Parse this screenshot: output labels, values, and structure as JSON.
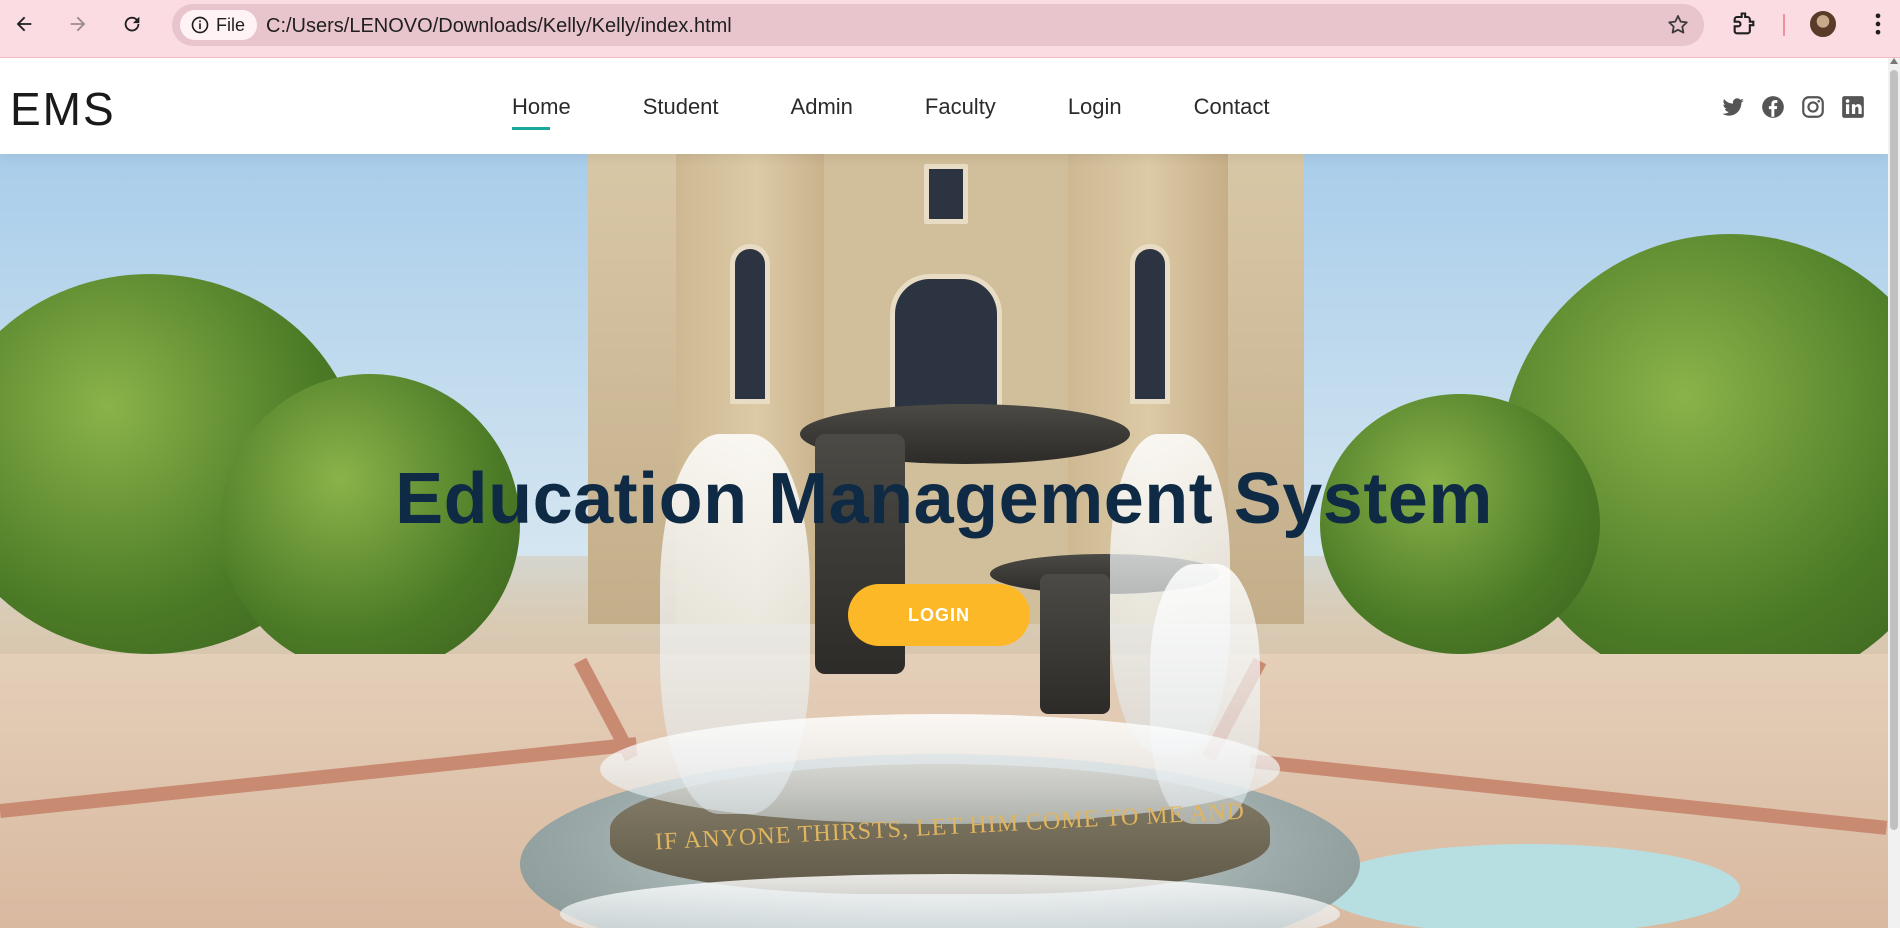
{
  "browser": {
    "site_chip_label": "File",
    "url": "C:/Users/LENOVO/Downloads/Kelly/Kelly/index.html"
  },
  "header": {
    "logo": "EMS",
    "menu": [
      {
        "label": "Home",
        "active": true
      },
      {
        "label": "Student",
        "active": false
      },
      {
        "label": "Admin",
        "active": false
      },
      {
        "label": "Faculty",
        "active": false
      },
      {
        "label": "Login",
        "active": false
      },
      {
        "label": "Contact",
        "active": false
      }
    ],
    "socials": [
      "twitter-icon",
      "facebook-icon",
      "instagram-icon",
      "linkedin-icon"
    ]
  },
  "hero": {
    "title": "Education Management System",
    "button_label": "LOGIN",
    "inscription": "IF ANYONE THIRSTS, LET HIM COME TO ME AND"
  },
  "colors": {
    "accent": "#1aa89a",
    "button": "#fdb827",
    "title": "#0f2a45",
    "chrome": "#fbdce3"
  }
}
